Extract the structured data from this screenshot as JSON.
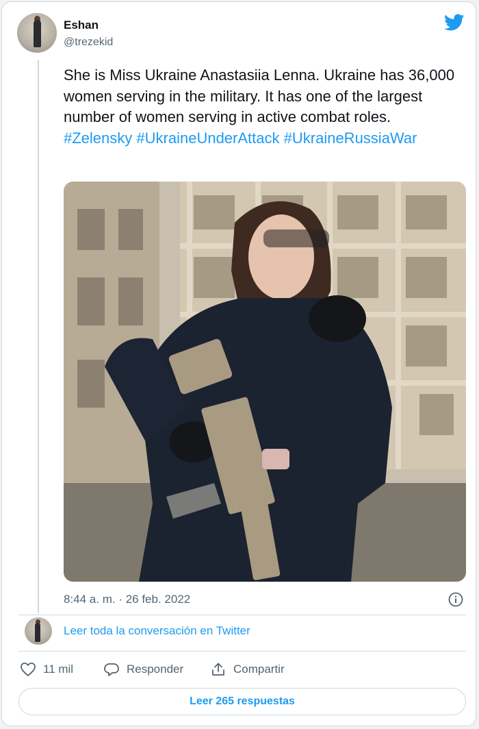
{
  "author": {
    "name": "Eshan",
    "handle": "@trezekid"
  },
  "tweet": {
    "text": "She is Miss Ukraine Anastasiia Lenna. Ukraine has 36,000 women serving in the military. It has one of the largest number of women serving in active combat roles.",
    "hashtags": [
      "#Zelensky",
      "#UkraineUnderAttack",
      "#UkraineRussiaWar"
    ],
    "timestamp": "8:44 a. m. · 26 feb. 2022"
  },
  "conversation": {
    "link_label": "Leer toda la conversación en Twitter"
  },
  "actions": {
    "likes": "11 mil",
    "reply_label": "Responder",
    "share_label": "Compartir"
  },
  "replies_button": {
    "label": "Leer 265 respuestas"
  },
  "icons": {
    "brand": "twitter-bird-icon",
    "info": "info-icon",
    "like": "heart-icon",
    "reply": "speech-bubble-icon",
    "share": "share-icon"
  },
  "colors": {
    "accent": "#1d9bf0",
    "text": "#0f1419",
    "muted": "#536471",
    "border": "#cfd9de"
  }
}
